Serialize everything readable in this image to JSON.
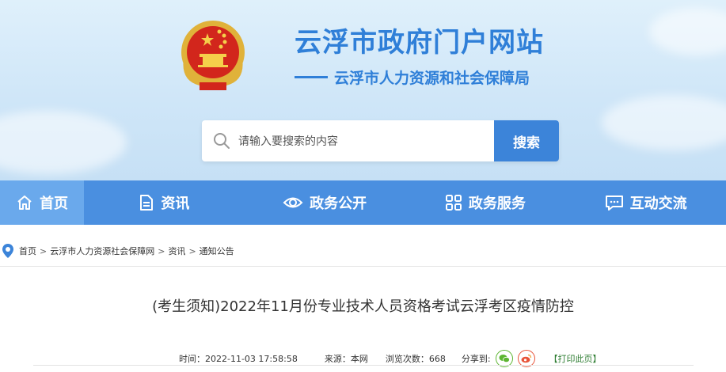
{
  "header": {
    "site_title": "云浮市政府门户网站",
    "site_subtitle": "云浮市人力资源和社会保障局",
    "emblem": "national-emblem"
  },
  "search": {
    "placeholder": "请输入要搜索的内容",
    "button_label": "搜索",
    "icon": "search-icon"
  },
  "nav": {
    "items": [
      {
        "label": "首页",
        "icon": "home-icon",
        "active": true
      },
      {
        "label": "资讯",
        "icon": "document-icon"
      },
      {
        "label": "政务公开",
        "icon": "eye-icon"
      },
      {
        "label": "政务服务",
        "icon": "grid-icon"
      },
      {
        "label": "互动交流",
        "icon": "chat-icon"
      }
    ]
  },
  "breadcrumb": {
    "items": [
      "首页",
      "云浮市人力资源社会保障网",
      "资讯",
      "通知公告"
    ],
    "separator": ">"
  },
  "article": {
    "title": "(考生须知)2022年11月份专业技术人员资格考试云浮考区疫情防控",
    "time": "时间：2022-11-03 17:58:58",
    "source": "来源：本网",
    "views": "浏览次数：668",
    "share_label": "分享到:",
    "print_label": "【打印此页】"
  },
  "colors": {
    "brand_blue": "#2f7fd8",
    "nav_blue": "#4a8fe0",
    "nav_active": "#6aa9ec",
    "search_button": "#3c84d9",
    "wechat_green": "#5cb531",
    "weibo_red": "#e8543a"
  }
}
